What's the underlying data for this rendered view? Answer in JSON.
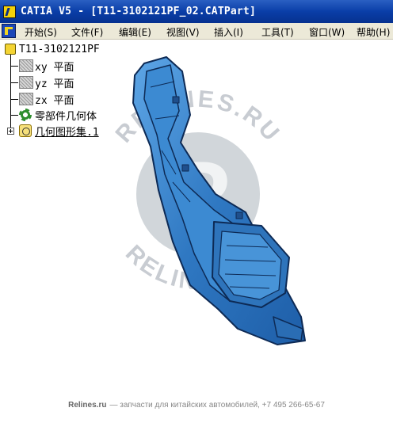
{
  "window": {
    "title": "CATIA V5 - [T11-3102121PF_02.CATPart]"
  },
  "menu": {
    "items": [
      {
        "label": "开始(S)"
      },
      {
        "label": "文件(F)"
      },
      {
        "label": "编辑(E)"
      },
      {
        "label": "视图(V)"
      },
      {
        "label": "插入(I)"
      },
      {
        "label": "工具(T)"
      },
      {
        "label": "窗口(W)"
      },
      {
        "label": "帮助(H)"
      }
    ]
  },
  "tree": {
    "root": "T11-3102121PF",
    "nodes": [
      {
        "label": "xy 平面",
        "icon": "plane-icon"
      },
      {
        "label": "yz 平面",
        "icon": "plane-icon"
      },
      {
        "label": "zx 平面",
        "icon": "plane-icon"
      },
      {
        "label": "零部件几何体",
        "icon": "part-body-gear-icon"
      },
      {
        "label": "几何图形集.1",
        "icon": "geometrical-set-icon"
      }
    ]
  },
  "watermark": {
    "text_top": "RELINES.RU",
    "text_bottom": "RELINES.RU",
    "letter": "R"
  },
  "footer": {
    "brand": "Relines.ru",
    "text": "— запчасти для китайских автомобилей, +7 495 266-65-67"
  },
  "colors": {
    "titlebar": "#0a3ea8",
    "menubar": "#ece9d8",
    "part_fill": "#3a83c9",
    "part_edge": "#0d2a55",
    "watermark": "#9aa3ad"
  }
}
